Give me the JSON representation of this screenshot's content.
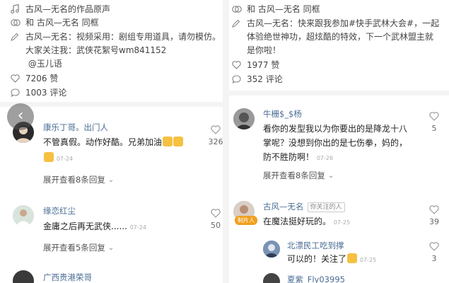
{
  "left": {
    "music": "古风—无名的作品原声",
    "with": "和 古风—无名 同框",
    "desc": "古风—无名：视频采用：剧组专用道具，请勿模仿。\n大家关注我：武侠花絮号wm841152\n @玉儿语",
    "likes": "7206 赞",
    "comments": "1003 评论",
    "c1": {
      "name": "康乐丁哥。出门人",
      "text": "不管真假。动作好酷。兄弟加油",
      "time": "07-24",
      "likes": "326",
      "more": "展开查看8条回复"
    },
    "c2": {
      "name": "缘恋红尘",
      "text": "金庸之后再无武侠......",
      "time": "07-24",
      "likes": "50",
      "more": "展开查看5条回复"
    },
    "c3": {
      "name": "广西贵港荣哥"
    }
  },
  "right": {
    "with": "和 古风—无名 同框",
    "desc": "古风—无名：快来跟我参加#快手武林大会#，一起\n体验绝世神功，超炫酷的特效，下一个武林盟主就\n是你啦！",
    "likes": "1977 赞",
    "comments": "352 评论",
    "c1": {
      "name": "牛栅$_$杨",
      "text": "看你的发型我以为你要出的是降龙十八\n掌呢？没想到你出的是七伤拳，妈的，\n防不胜防啊！",
      "time": "07-26",
      "likes": "5",
      "more": "展开查看8条回复"
    },
    "c2": {
      "name": "古风—无名",
      "tag": "你关注的人",
      "badge": "制片人",
      "text": "在魔法挺好玩的。",
      "time": "07-25",
      "likes": "39"
    },
    "r1": {
      "name": "北漂民工吃到撑",
      "text": "可以的！关注了",
      "time": "07-25",
      "likes": "3"
    },
    "r2": {
      "name": "夏紫_Fly03995"
    }
  },
  "back": "‹"
}
